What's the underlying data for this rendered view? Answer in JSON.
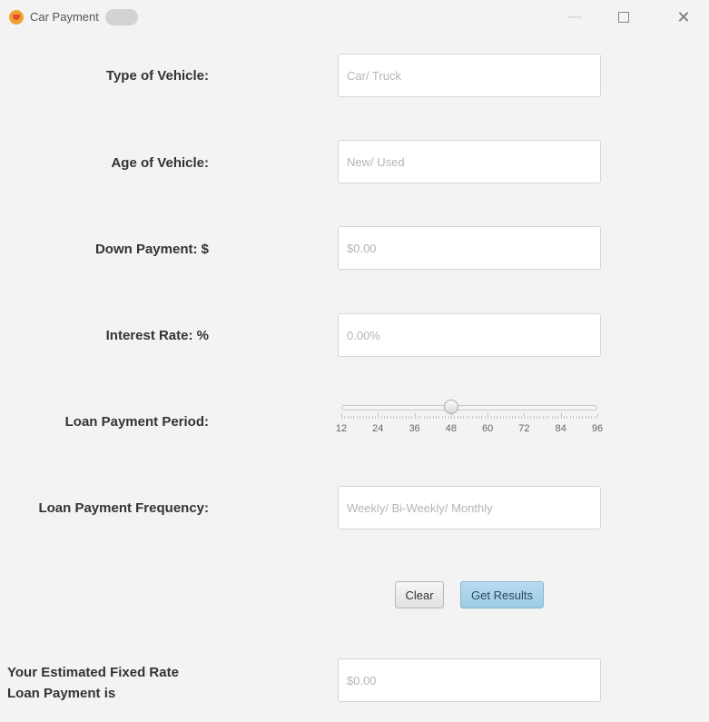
{
  "window": {
    "title": "Car Payment",
    "controls": {
      "minimize": "—",
      "maximize": "□",
      "close": "✕"
    }
  },
  "form": {
    "vehicle_type": {
      "label": "Type of Vehicle:",
      "value": "",
      "placeholder": "Car/ Truck"
    },
    "vehicle_age": {
      "label": "Age of Vehicle:",
      "value": "",
      "placeholder": "New/ Used"
    },
    "down_payment": {
      "label": "Down Payment: $",
      "value": "",
      "placeholder": "$0.00"
    },
    "interest_rate": {
      "label": "Interest Rate: %",
      "value": "",
      "placeholder": "0.00%"
    },
    "loan_period": {
      "label": "Loan Payment Period:",
      "min": 12,
      "max": 96,
      "value": 48,
      "tick_labels": [
        "12",
        "24",
        "36",
        "48",
        "60",
        "72",
        "84",
        "96"
      ]
    },
    "loan_frequency": {
      "label": "Loan Payment Frequency:",
      "value": "",
      "placeholder": "Weekly/ Bi-Weekly/ Monthly"
    }
  },
  "buttons": {
    "clear": "Clear",
    "get_results": "Get Results"
  },
  "result": {
    "label_line1": "Your Estimated Fixed Rate",
    "label_line2": "Loan Payment is",
    "value": "",
    "placeholder": "$0.00"
  },
  "colors": {
    "accent_button": "#a8d2ea",
    "background": "#f3f3f3"
  }
}
